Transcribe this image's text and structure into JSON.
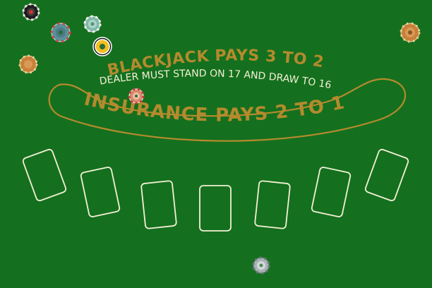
{
  "table": {
    "felt_color": "#14701e",
    "line_color": "#f4efd6",
    "gold_color": "#b58a2e",
    "headline": "BLACKJACK PAYS 3 TO 2",
    "rule": "DEALER MUST STAND ON 17 AND DRAW TO 16",
    "insurance": "INSURANCE PAYS 2 TO 1"
  },
  "betting_spots": [
    {
      "name": "betting-spot-1"
    },
    {
      "name": "betting-spot-2"
    },
    {
      "name": "betting-spot-3"
    },
    {
      "name": "betting-spot-4"
    },
    {
      "name": "betting-spot-5"
    },
    {
      "name": "betting-spot-6"
    },
    {
      "name": "betting-spot-7"
    }
  ],
  "chips": [
    {
      "name": "chip-black",
      "color": "#1c1c1c",
      "accent": "#e8e8e8"
    },
    {
      "name": "chip-teal",
      "color": "#5a8f98",
      "accent": "#d23c3c"
    },
    {
      "name": "chip-mint",
      "color": "#7fb8a8",
      "accent": "#f2f2f2"
    },
    {
      "name": "chip-yellow",
      "color": "#f0c020",
      "accent": "#1a1a1a"
    },
    {
      "name": "chip-orange-left",
      "color": "#c8803a",
      "accent": "#f3d7a0"
    },
    {
      "name": "chip-orange-right",
      "color": "#c8803a",
      "accent": "#f3d7a0"
    },
    {
      "name": "chip-red",
      "color": "#d88a6a",
      "accent": "#f5f5f5"
    },
    {
      "name": "chip-grey",
      "color": "#a9b3b5",
      "accent": "#6c7a7c"
    }
  ]
}
